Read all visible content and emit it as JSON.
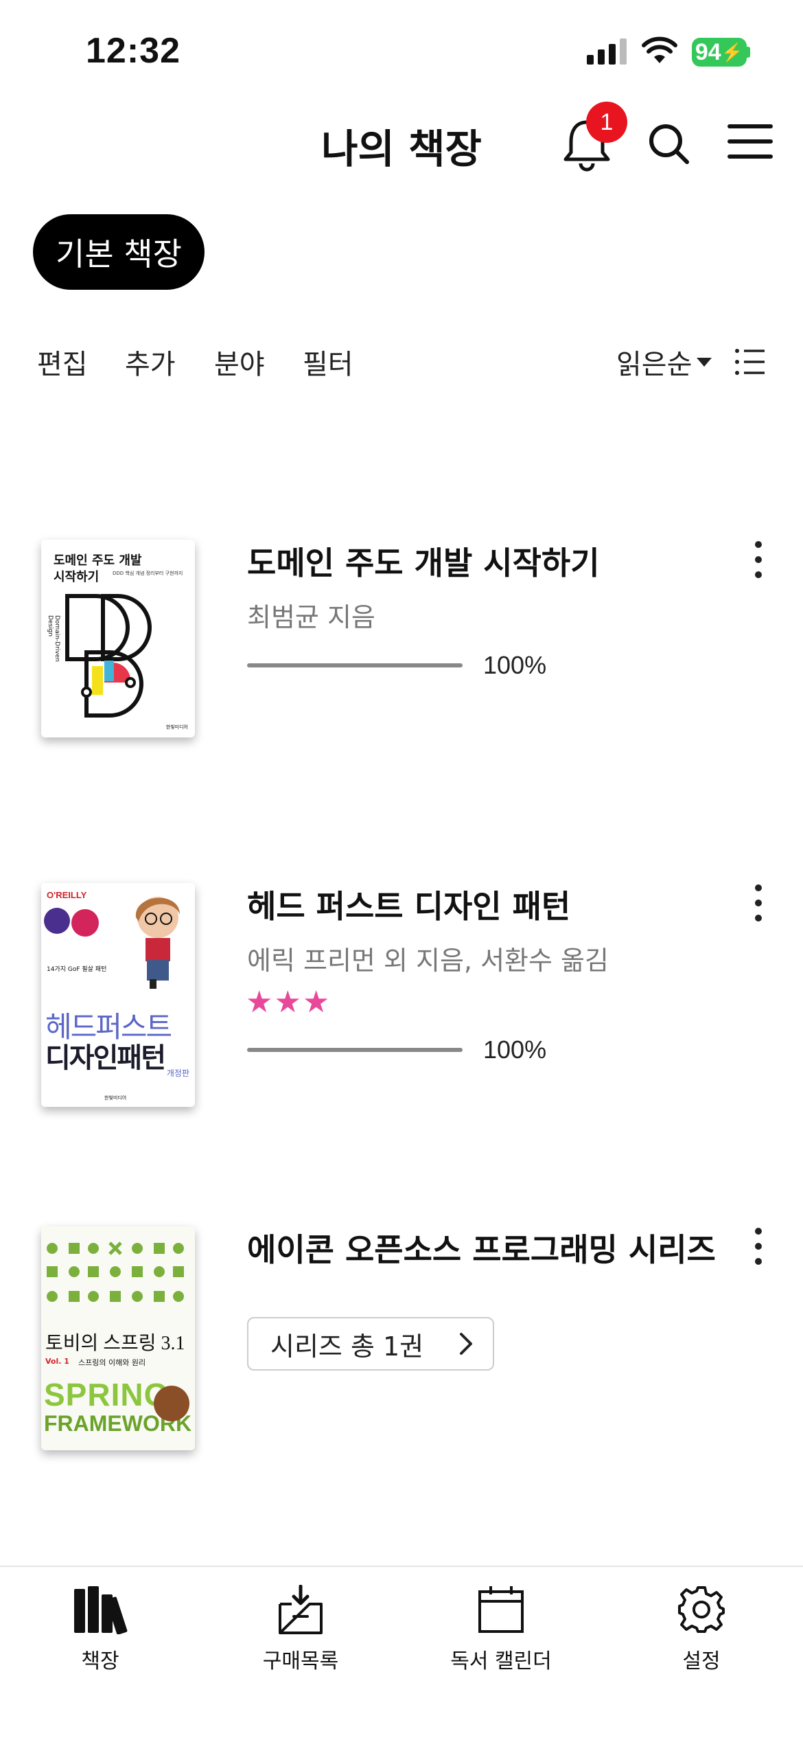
{
  "status_bar": {
    "time": "12:32",
    "battery": "94"
  },
  "header": {
    "title": "나의 책장",
    "notification_count": "1"
  },
  "shelf_selector": {
    "label": "기본 책장"
  },
  "toolbar": {
    "edit": "편집",
    "add": "추가",
    "category": "분야",
    "filter": "필터",
    "sort": "읽은순"
  },
  "books": [
    {
      "title": "도메인 주도 개발 시작하기",
      "author": "최범균 지음",
      "progress_percent": 100,
      "progress_label": "100%"
    },
    {
      "title": "헤드 퍼스트 디자인 패턴",
      "author": "에릭 프리먼 외 지음, 서환수 옮김",
      "rating": 3,
      "rating_stars": "★★★",
      "progress_percent": 100,
      "progress_label": "100%"
    },
    {
      "title": "에이콘 오픈소스 프로그래밍 시리즈",
      "series_button": "시리즈 총 1권"
    }
  ],
  "covers": {
    "ddd": {
      "title_line1": "도메인 주도 개발",
      "title_line2": "시작하기",
      "subtitle": "DDD 핵심 개념 정리부터 구현까지",
      "spine_text": "Domain-Driven Design",
      "publisher": "한빛미디어"
    },
    "headfirst": {
      "publisher_logo": "O'REILLY",
      "tagline": "14가지 GoF 필살 패턴",
      "title_line1": "헤드퍼스트",
      "title_line2": "디자인패턴",
      "edition": "개정판",
      "publisher": "한빛미디어"
    },
    "spring": {
      "title": "토비의 스프링 3.1",
      "vol": "Vol. 1",
      "vol_subtitle": "스프링의 이해와 원리",
      "logo_line1": "SPRING",
      "logo_line2": "FRAMEWORK"
    }
  },
  "tabs": [
    {
      "label": "책장"
    },
    {
      "label": "구매목록"
    },
    {
      "label": "독서 캘린더"
    },
    {
      "label": "설정"
    }
  ],
  "colors": {
    "accent_badge": "#e8141f",
    "stars": "#e8479a",
    "battery": "#34c759"
  }
}
